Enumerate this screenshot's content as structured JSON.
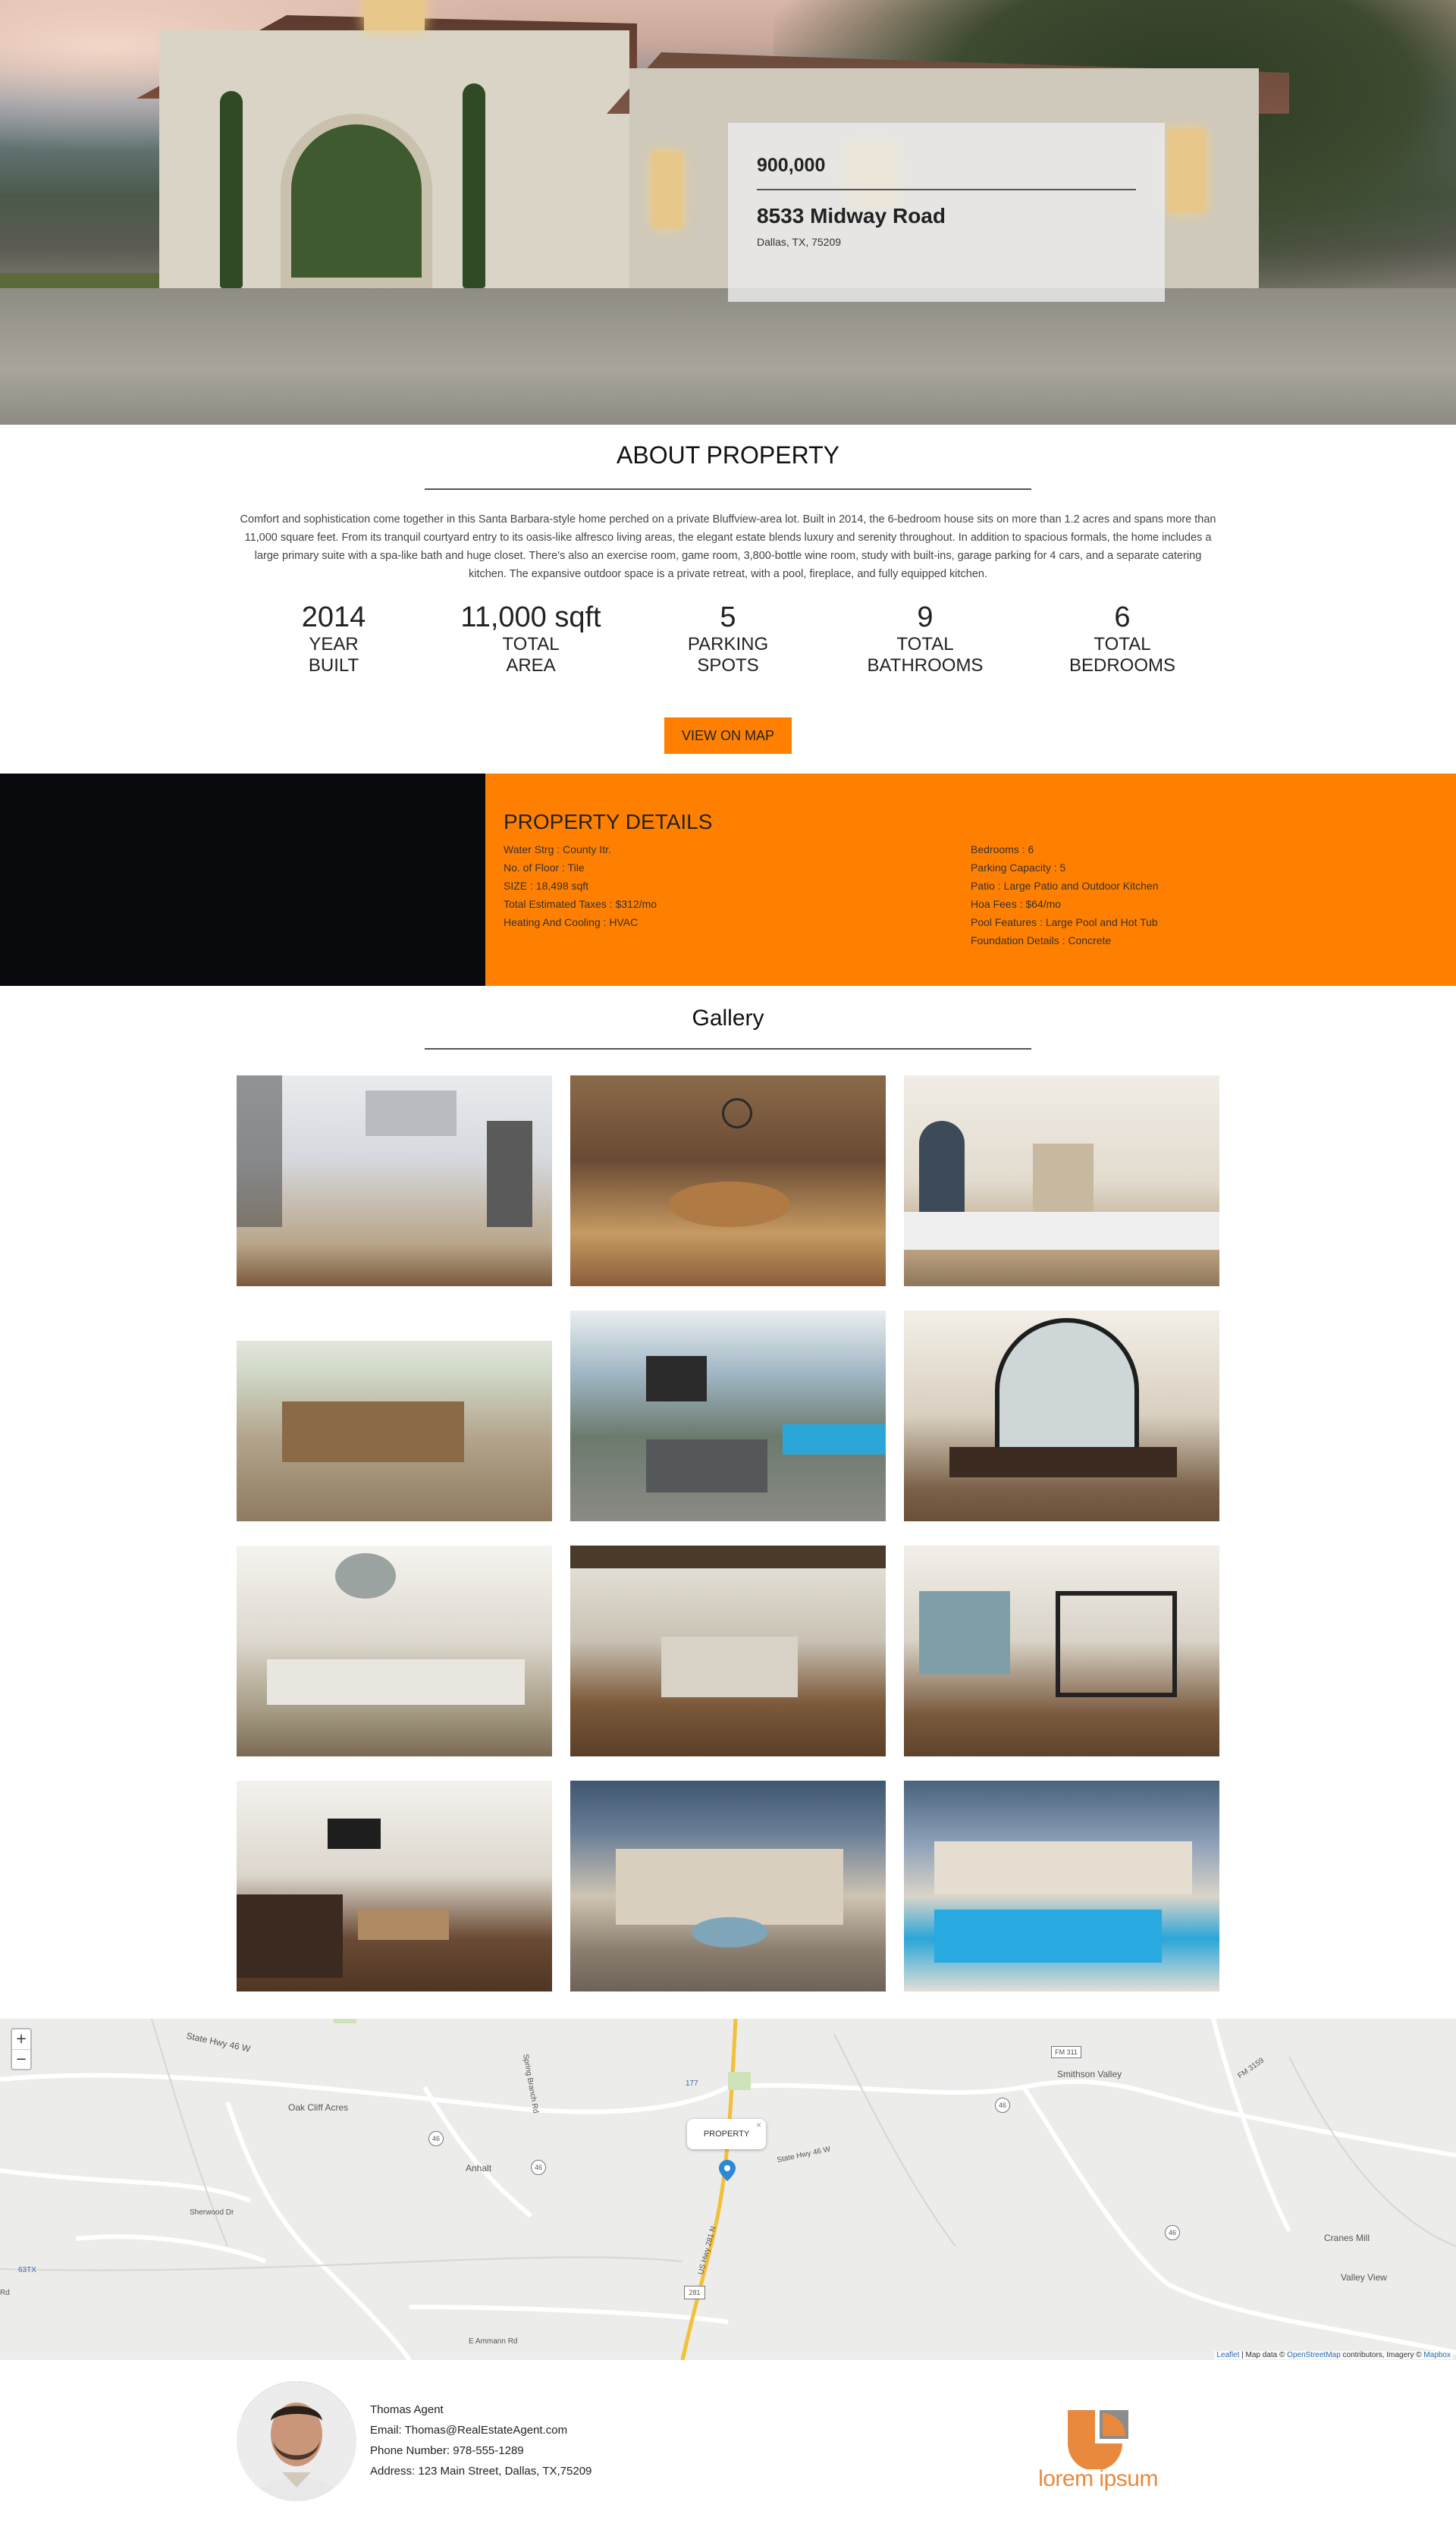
{
  "hero": {
    "price": "900,000",
    "address": "8533 Midway Road",
    "city": "Dallas, TX, 75209"
  },
  "about": {
    "title": "ABOUT PROPERTY",
    "description": "Comfort and sophistication come together in this Santa Barbara-style home perched on a private Bluffview-area lot. Built in 2014, the 6-bedroom house sits on more than 1.2 acres and spans more than 11,000 square feet. From its tranquil courtyard entry to its oasis-like alfresco living areas, the elegant estate blends luxury and serenity throughout. In addition to spacious formals, the home includes a large primary suite with a spa-like bath and huge closet. There's also an exercise room, game room, 3,800-bottle wine room, study with built-ins, garage parking for 4 cars, and a separate catering kitchen. The expansive outdoor space is a private retreat, with a pool, fireplace, and fully equipped kitchen.",
    "stats": [
      {
        "value": "2014",
        "label1": "YEAR",
        "label2": "BUILT"
      },
      {
        "value": "11,000 sqft",
        "label1": "TOTAL",
        "label2": "AREA"
      },
      {
        "value": "5",
        "label1": "PARKING",
        "label2": "SPOTS"
      },
      {
        "value": "9",
        "label1": "TOTAL",
        "label2": "BATHROOMS"
      },
      {
        "value": "6",
        "label1": "TOTAL",
        "label2": "BEDROOMS"
      }
    ],
    "map_button": "VIEW ON MAP"
  },
  "details": {
    "title": "PROPERTY DETAILS",
    "left": [
      "Water Strg : County Itr.",
      "No. of Floor : Tile",
      "SIZE : 18,498 sqft",
      "Total Estimated Taxes : $312/mo",
      "Heating And Cooling : HVAC"
    ],
    "right": [
      "Bedrooms : 6",
      "Parking Capacity : 5",
      "Patio : Large Patio and Outdoor Kitchen",
      "Hoa Fees : $64/mo",
      "Pool Features : Large Pool and Hot Tub",
      "Foundation Details : Concrete"
    ]
  },
  "gallery": {
    "title": "Gallery",
    "images": [
      "kitchen",
      "wine-room",
      "living-room",
      "outdoor-kitchen",
      "patio",
      "dining-room",
      "dining-room-2",
      "kitchen-island",
      "bedroom",
      "family-room",
      "courtyard",
      "pool"
    ]
  },
  "map": {
    "zoom_in": "+",
    "zoom_out": "−",
    "popup": "PROPERTY",
    "popup_close": "×",
    "labels": {
      "state_hwy_46_w_top": "State Hwy 46 W",
      "oak_cliff": "Oak Cliff Acres",
      "anhalt": "Anhalt",
      "sherwood": "Sherwood Dr",
      "smithson": "Smithson Valley",
      "cranes": "Cranes Mill",
      "valley_view": "Valley View",
      "state_hwy_46_w": "State Hwy 46 W",
      "fm3159": "FM 3159",
      "spring_branch": "Spring Branch Rd",
      "e_ammann": "E Ammann Rd",
      "us_hwy_281": "US Hwy 281 N",
      "badge_46a": "46",
      "badge_46b": "46",
      "badge_46c": "46",
      "badge_46d": "46",
      "badge_281": "281",
      "badge_fm311": "FM 311",
      "lastx": "63TX",
      "num177": "177",
      "rd": "Rd"
    },
    "attribution_leaflet": "Leaflet",
    "attribution_mid": " | Map data © ",
    "attribution_osm": "OpenStreetMap",
    "attribution_rest": " contributors, Imagery © ",
    "attribution_mapbox": "Mapbox"
  },
  "agent": {
    "name": "Thomas Agent",
    "email": "Email: Thomas@RealEstateAgent.com",
    "phone": "Phone Number: 978-555-1289",
    "address": "Address: 123 Main Street, Dallas, TX,75209"
  },
  "logo": {
    "text": "lorem ipsum",
    "colors": {
      "orange": "#e8893e",
      "gray": "#8c8c8c"
    }
  },
  "colors": {
    "accent": "#ff8000",
    "dark": "#08090d"
  }
}
